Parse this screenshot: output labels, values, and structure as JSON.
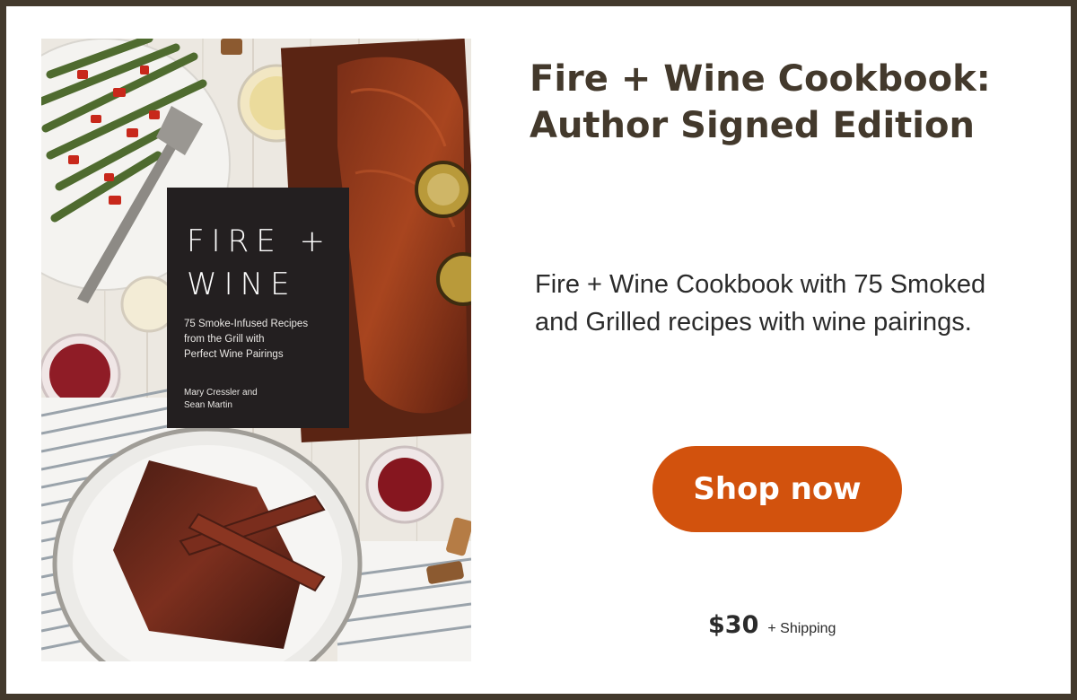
{
  "product": {
    "title_line1": "Fire + Wine Cookbook:",
    "title_line2": "Author Signed Edition",
    "description_line1": "Fire + Wine Cookbook with 75 Smoked",
    "description_line2": "and Grilled recipes with wine pairings.",
    "price": "$30",
    "shipping_note": "+ Shipping"
  },
  "cta": {
    "label": "Shop now"
  },
  "cover": {
    "title_line1": "FIRE +",
    "title_line2": "WINE",
    "subtitle_line1": "75 Smoke-Infused Recipes",
    "subtitle_line2": "from the Grill with",
    "subtitle_line3": "Perfect Wine Pairings",
    "authors_line1": "Mary Cressler and",
    "authors_line2": "Sean Martin"
  },
  "colors": {
    "frame": "#43392c",
    "heading": "#43392c",
    "button": "#d2520d",
    "cover_label": "#231f20"
  }
}
